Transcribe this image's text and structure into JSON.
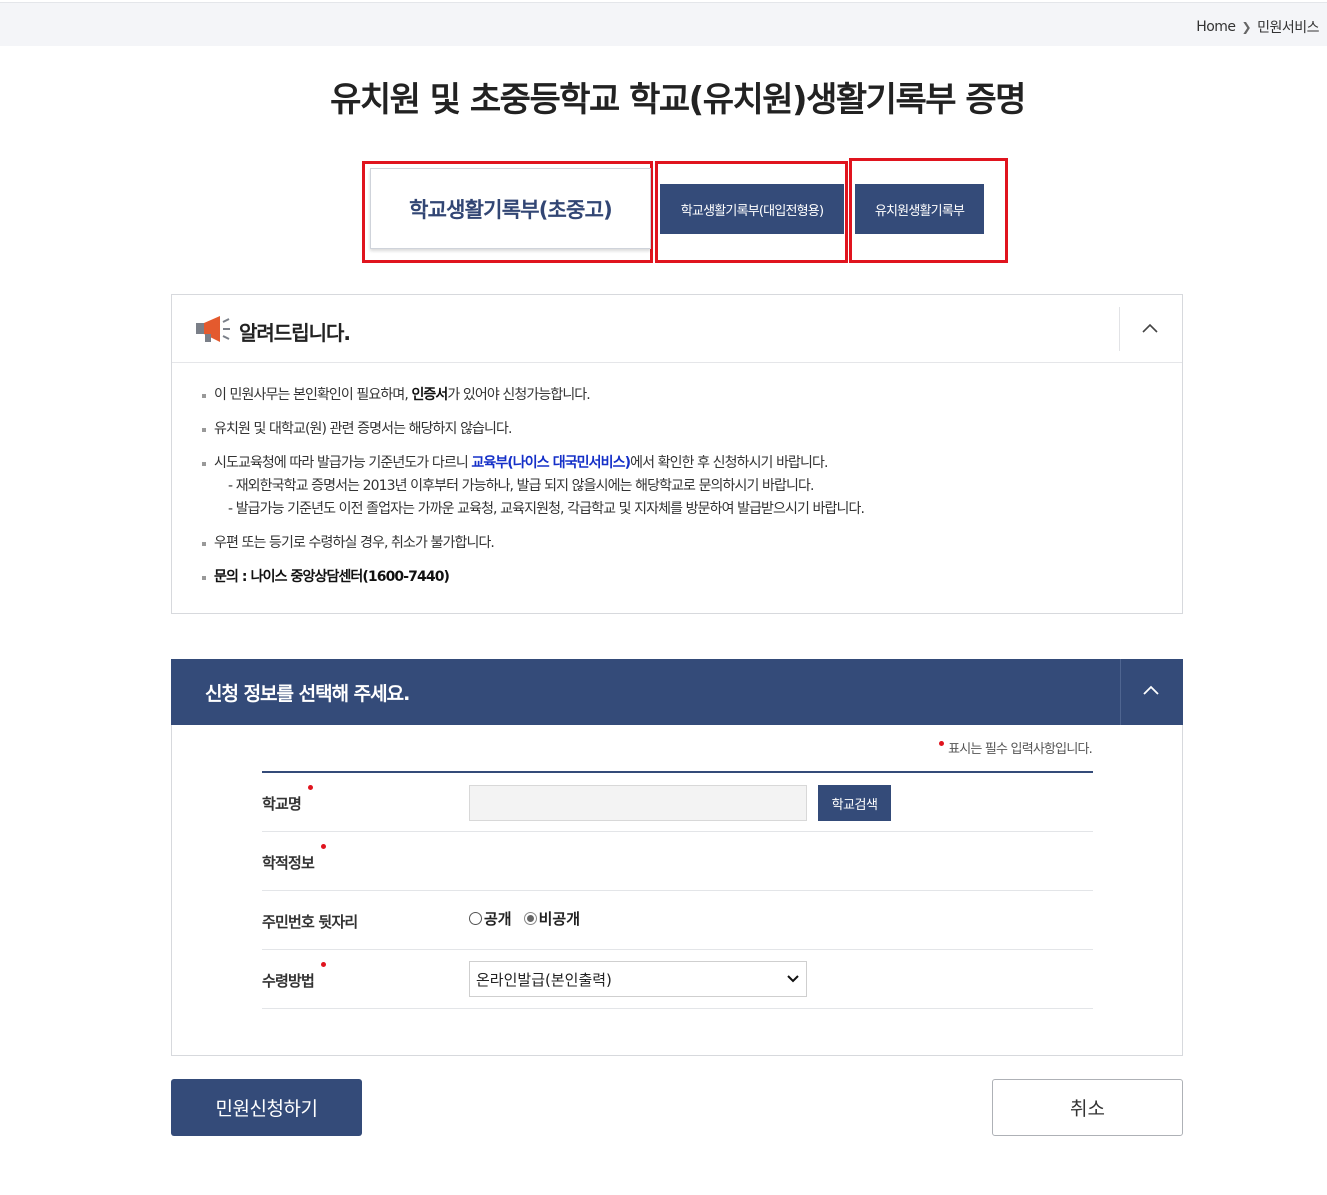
{
  "breadcrumb": {
    "home": "Home",
    "current": "민원서비스"
  },
  "page_title": "유치원 및 초중등학교 학교(유치원)생활기록부 증명",
  "tabs": [
    {
      "label": "학교생활기록부(초중고)",
      "active": true
    },
    {
      "label": "학교생활기록부(대입전형용)",
      "active": false
    },
    {
      "label": "유치원생활기록부",
      "active": false
    }
  ],
  "notice": {
    "title": "알려드립니다.",
    "line1_pre": "이 민원사무는 본인확인이 필요하며, ",
    "line1_bold": "인증서",
    "line1_post": "가 있어야 신청가능합니다.",
    "line2": "유치원 및 대학교(원) 관련 증명서는 해당하지 않습니다.",
    "line3_pre": "시도교육청에 따라 발급가능 기준년도가 다르니 ",
    "line3_link": "교육부(나이스 대국민서비스)",
    "line3_post": "에서 확인한 후 신청하시기 바랍니다.",
    "line3_sub1": "- 재외한국학교 증명서는 2013년 이후부터 가능하나, 발급 되지 않을시에는 해당학교로 문의하시기 바랍니다.",
    "line3_sub2": "- 발급가능 기준년도 이전 졸업자는 가까운 교육청, 교육지원청, 각급학교 및 지자체를 방문하여 발급받으시기 바랍니다.",
    "line4": "우편 또는 등기로 수령하실 경우, 취소가 불가합니다.",
    "line5": "문의 : 나이스 중앙상담센터(1600-7440)"
  },
  "apply": {
    "title": "신청 정보를 선택해 주세요.",
    "required_note": "표시는 필수 입력사항입니다.",
    "school_label": "학교명",
    "school_value": "",
    "school_search_button": "학교검색",
    "record_label": "학적정보",
    "rrn_label": "주민번호 뒷자리",
    "rrn_options": [
      "공개",
      "비공개"
    ],
    "rrn_selected": "비공개",
    "receive_label": "수령방법",
    "receive_selected": "온라인발급(본인출력)"
  },
  "buttons": {
    "apply": "민원신청하기",
    "cancel": "취소"
  },
  "colors": {
    "primary": "#344b79",
    "highlight": "#e0141e",
    "link": "#1530c8"
  }
}
